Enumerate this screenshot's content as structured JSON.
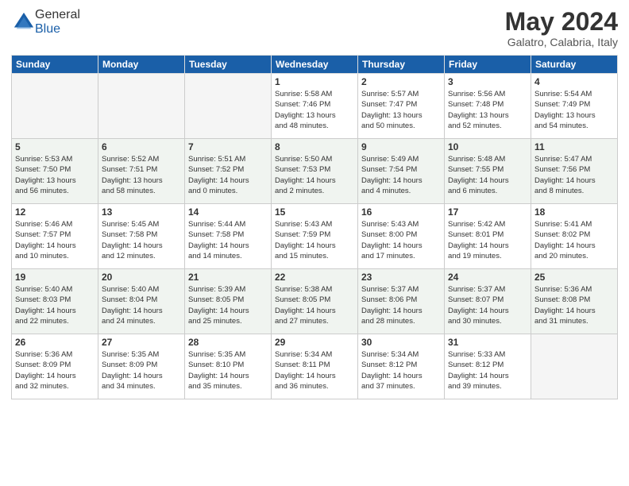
{
  "header": {
    "logo_general": "General",
    "logo_blue": "Blue",
    "month_title": "May 2024",
    "location": "Galatro, Calabria, Italy"
  },
  "days_of_week": [
    "Sunday",
    "Monday",
    "Tuesday",
    "Wednesday",
    "Thursday",
    "Friday",
    "Saturday"
  ],
  "weeks": [
    [
      {
        "day": "",
        "info": ""
      },
      {
        "day": "",
        "info": ""
      },
      {
        "day": "",
        "info": ""
      },
      {
        "day": "1",
        "info": "Sunrise: 5:58 AM\nSunset: 7:46 PM\nDaylight: 13 hours\nand 48 minutes."
      },
      {
        "day": "2",
        "info": "Sunrise: 5:57 AM\nSunset: 7:47 PM\nDaylight: 13 hours\nand 50 minutes."
      },
      {
        "day": "3",
        "info": "Sunrise: 5:56 AM\nSunset: 7:48 PM\nDaylight: 13 hours\nand 52 minutes."
      },
      {
        "day": "4",
        "info": "Sunrise: 5:54 AM\nSunset: 7:49 PM\nDaylight: 13 hours\nand 54 minutes."
      }
    ],
    [
      {
        "day": "5",
        "info": "Sunrise: 5:53 AM\nSunset: 7:50 PM\nDaylight: 13 hours\nand 56 minutes."
      },
      {
        "day": "6",
        "info": "Sunrise: 5:52 AM\nSunset: 7:51 PM\nDaylight: 13 hours\nand 58 minutes."
      },
      {
        "day": "7",
        "info": "Sunrise: 5:51 AM\nSunset: 7:52 PM\nDaylight: 14 hours\nand 0 minutes."
      },
      {
        "day": "8",
        "info": "Sunrise: 5:50 AM\nSunset: 7:53 PM\nDaylight: 14 hours\nand 2 minutes."
      },
      {
        "day": "9",
        "info": "Sunrise: 5:49 AM\nSunset: 7:54 PM\nDaylight: 14 hours\nand 4 minutes."
      },
      {
        "day": "10",
        "info": "Sunrise: 5:48 AM\nSunset: 7:55 PM\nDaylight: 14 hours\nand 6 minutes."
      },
      {
        "day": "11",
        "info": "Sunrise: 5:47 AM\nSunset: 7:56 PM\nDaylight: 14 hours\nand 8 minutes."
      }
    ],
    [
      {
        "day": "12",
        "info": "Sunrise: 5:46 AM\nSunset: 7:57 PM\nDaylight: 14 hours\nand 10 minutes."
      },
      {
        "day": "13",
        "info": "Sunrise: 5:45 AM\nSunset: 7:58 PM\nDaylight: 14 hours\nand 12 minutes."
      },
      {
        "day": "14",
        "info": "Sunrise: 5:44 AM\nSunset: 7:58 PM\nDaylight: 14 hours\nand 14 minutes."
      },
      {
        "day": "15",
        "info": "Sunrise: 5:43 AM\nSunset: 7:59 PM\nDaylight: 14 hours\nand 15 minutes."
      },
      {
        "day": "16",
        "info": "Sunrise: 5:43 AM\nSunset: 8:00 PM\nDaylight: 14 hours\nand 17 minutes."
      },
      {
        "day": "17",
        "info": "Sunrise: 5:42 AM\nSunset: 8:01 PM\nDaylight: 14 hours\nand 19 minutes."
      },
      {
        "day": "18",
        "info": "Sunrise: 5:41 AM\nSunset: 8:02 PM\nDaylight: 14 hours\nand 20 minutes."
      }
    ],
    [
      {
        "day": "19",
        "info": "Sunrise: 5:40 AM\nSunset: 8:03 PM\nDaylight: 14 hours\nand 22 minutes."
      },
      {
        "day": "20",
        "info": "Sunrise: 5:40 AM\nSunset: 8:04 PM\nDaylight: 14 hours\nand 24 minutes."
      },
      {
        "day": "21",
        "info": "Sunrise: 5:39 AM\nSunset: 8:05 PM\nDaylight: 14 hours\nand 25 minutes."
      },
      {
        "day": "22",
        "info": "Sunrise: 5:38 AM\nSunset: 8:05 PM\nDaylight: 14 hours\nand 27 minutes."
      },
      {
        "day": "23",
        "info": "Sunrise: 5:37 AM\nSunset: 8:06 PM\nDaylight: 14 hours\nand 28 minutes."
      },
      {
        "day": "24",
        "info": "Sunrise: 5:37 AM\nSunset: 8:07 PM\nDaylight: 14 hours\nand 30 minutes."
      },
      {
        "day": "25",
        "info": "Sunrise: 5:36 AM\nSunset: 8:08 PM\nDaylight: 14 hours\nand 31 minutes."
      }
    ],
    [
      {
        "day": "26",
        "info": "Sunrise: 5:36 AM\nSunset: 8:09 PM\nDaylight: 14 hours\nand 32 minutes."
      },
      {
        "day": "27",
        "info": "Sunrise: 5:35 AM\nSunset: 8:09 PM\nDaylight: 14 hours\nand 34 minutes."
      },
      {
        "day": "28",
        "info": "Sunrise: 5:35 AM\nSunset: 8:10 PM\nDaylight: 14 hours\nand 35 minutes."
      },
      {
        "day": "29",
        "info": "Sunrise: 5:34 AM\nSunset: 8:11 PM\nDaylight: 14 hours\nand 36 minutes."
      },
      {
        "day": "30",
        "info": "Sunrise: 5:34 AM\nSunset: 8:12 PM\nDaylight: 14 hours\nand 37 minutes."
      },
      {
        "day": "31",
        "info": "Sunrise: 5:33 AM\nSunset: 8:12 PM\nDaylight: 14 hours\nand 39 minutes."
      },
      {
        "day": "",
        "info": ""
      }
    ]
  ]
}
